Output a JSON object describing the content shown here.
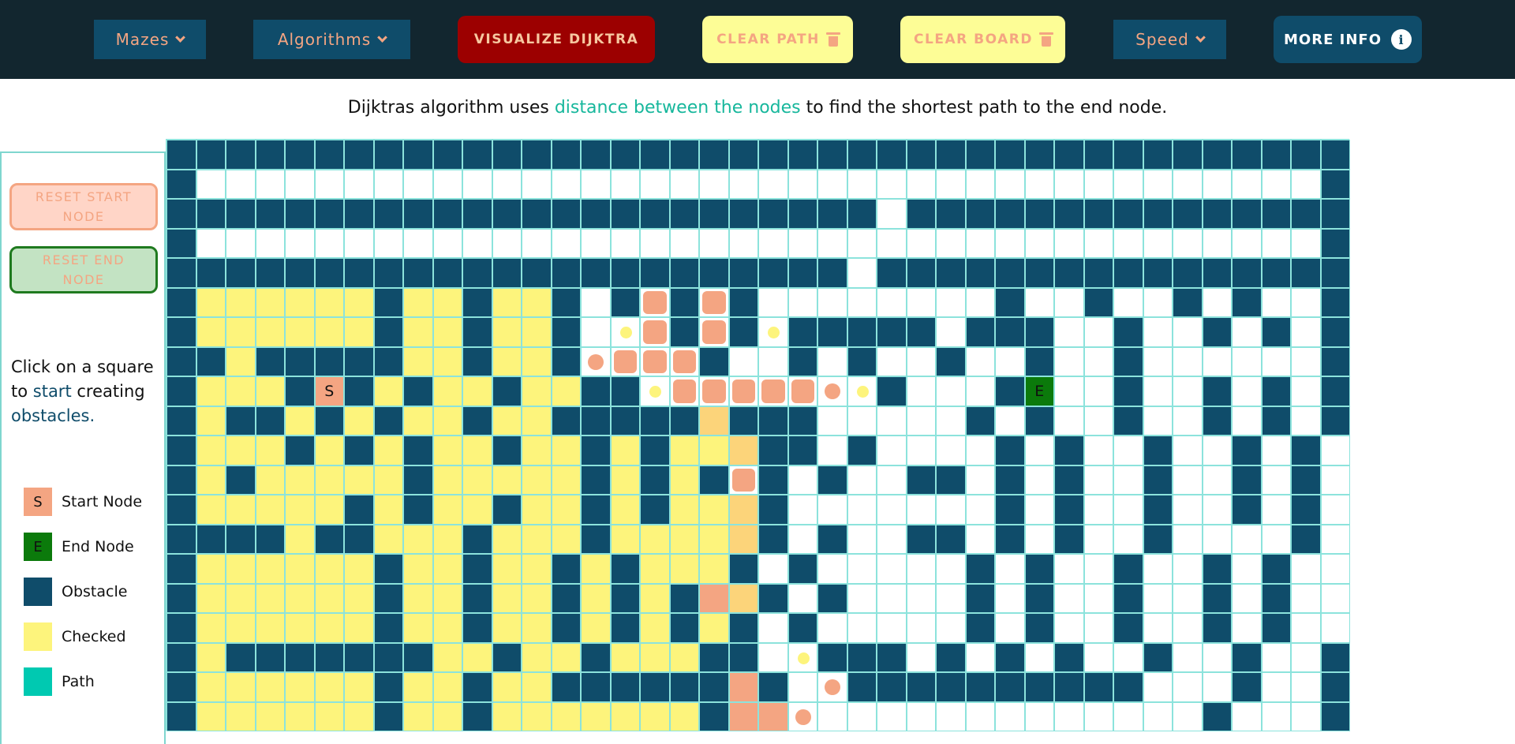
{
  "navbar": {
    "mazes_label": "Mazes",
    "algorithms_label": "Algorithms",
    "visualize_label": "VISUALIZE DIJKTRA",
    "clear_path_label": "CLEAR PATH",
    "clear_board_label": "CLEAR BOARD",
    "speed_label": "Speed",
    "more_info_label": "MORE INFO",
    "info_icon": "i"
  },
  "description": {
    "prefix": "Dijktras algorithm uses ",
    "highlight": "distance between the nodes",
    "suffix": " to find the shortest path to the end node."
  },
  "panel": {
    "reset_start_label": "RESET START NODE",
    "reset_end_label": "RESET END NODE",
    "instructions": {
      "part1": "Click on a square to ",
      "start_word": "start",
      "part2": " creating ",
      "obstacles_word": "obstacles."
    },
    "legend": [
      {
        "key": "start",
        "symbol": "S",
        "label": "Start Node",
        "color": "#f4a582"
      },
      {
        "key": "end",
        "symbol": "E",
        "label": "End Node",
        "color": "#0b7a0b"
      },
      {
        "key": "obstacle",
        "symbol": "",
        "label": "Obstacle",
        "color": "#0f4c6a"
      },
      {
        "key": "checked",
        "symbol": "",
        "label": "Checked",
        "color": "#fdf47c"
      },
      {
        "key": "path",
        "symbol": "",
        "label": "Path",
        "color": "#00c9b1"
      }
    ]
  },
  "grid": {
    "start_symbol": "S",
    "end_symbol": "E",
    "legend_codes": "o=obstacle, w=empty, y=checked, s=start, e=end, b=animating-large, m=animating-mid, d=animating-small, p=path-trail, l=path-light",
    "rows": [
      "oooooooooooooooooooooooooooooooooooooooo",
      "owwwwwwwwwwwwwwwwwwwwwwwwwwwwwwwwwwwwwwo",
      "oooooooooooooooooooooooowooooooooooooooo",
      "owwwwwwwwwwwwwwwwwwwwwwwwwwwwwwwwwwwwwwo",
      "ooooooooooooooooooooooowoooooooooooooooo",
      "oyyyyyyoyyoyyowobobowwwwwwwwowwowwowowwo",
      "oyyyyyyoyyoyyowdbobodooooowooowwowwowowo",
      "ooyoooooyyoyyombbbowwowowwowwowwowwwwwwo",
      "oyyyosoyoyyoyyoodbbbbbmdowwwoewwowwowowo",
      "oyooyoyoyyoyyooooolooowwwwwowowwowwowowo",
      "oyyyoyoyoyyoyyoyoyyloowowwwwowowwowwowo",
      "oyoyyyyyoyyyyyoyoyobowowwoowowowwowwowo",
      "oyyyyyoyoyyoyyoyoyylowwwwwwwowowwowwowo",
      "ooooyooyyyoyyyoyyyylowowwoowowowwowwwwo",
      "oyyyyyyoyyoyyoyoyyyowowwwwwowowwowwowo",
      "oyyyyyyoyyoyyoyoyoplowowwwwowowwowwowo",
      "oyyyyyyoyyoyyoyoyoyowowwwwwowowwowwowo",
      "oyoooooooyyoyyoyyyoowdooowowowowwowwowwo",
      "oyyyyyyoyyoyyoooooopowmoooooooooowwwowwo",
      "oyyyyyyoyyoyyyyyyyoppmwwwwwwwwwwwwwowwwo"
    ]
  }
}
